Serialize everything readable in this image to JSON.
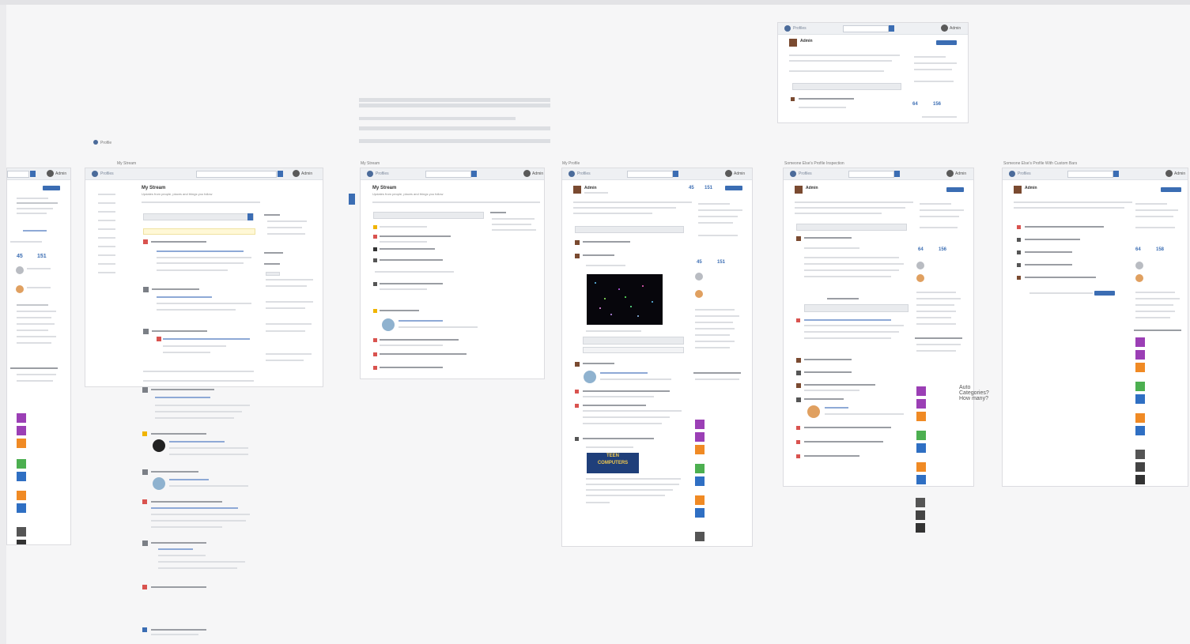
{
  "canvas": {
    "background": "#f6f6f7"
  },
  "labels": {
    "profile_small": "Profile",
    "frame2_title": "My Stream",
    "frame3_title": "My Stream",
    "frame4_title": "My Profile",
    "frame5_title": "Someone Else's Profile Inspection",
    "frame6_title": "Someone Else's Profile With Custom Bars"
  },
  "brand": "Profiles",
  "stream": {
    "heading": "My Stream",
    "subheading": "Updates from people, places and things you follow"
  },
  "profile": {
    "name": "Admin"
  },
  "stats": {
    "followers": "45",
    "following": "151",
    "f5a": "64",
    "f5b": "156",
    "f6a": "64",
    "f6b": "158"
  },
  "badge": {
    "line1": "TEEN",
    "line2": "COMPUTERS"
  },
  "note": "Auto Categories? How many?",
  "colors": {
    "accent": "#3b6db3",
    "header": "#eef0f3",
    "link": "#8ea9d6",
    "notify": "#d9534f",
    "purple": "#9b3fb5",
    "orange": "#f08a24",
    "green": "#4caf50",
    "blue": "#2f6fc3"
  },
  "icons": [
    "logo-icon",
    "search-icon",
    "avatar-icon",
    "gear-icon"
  ]
}
